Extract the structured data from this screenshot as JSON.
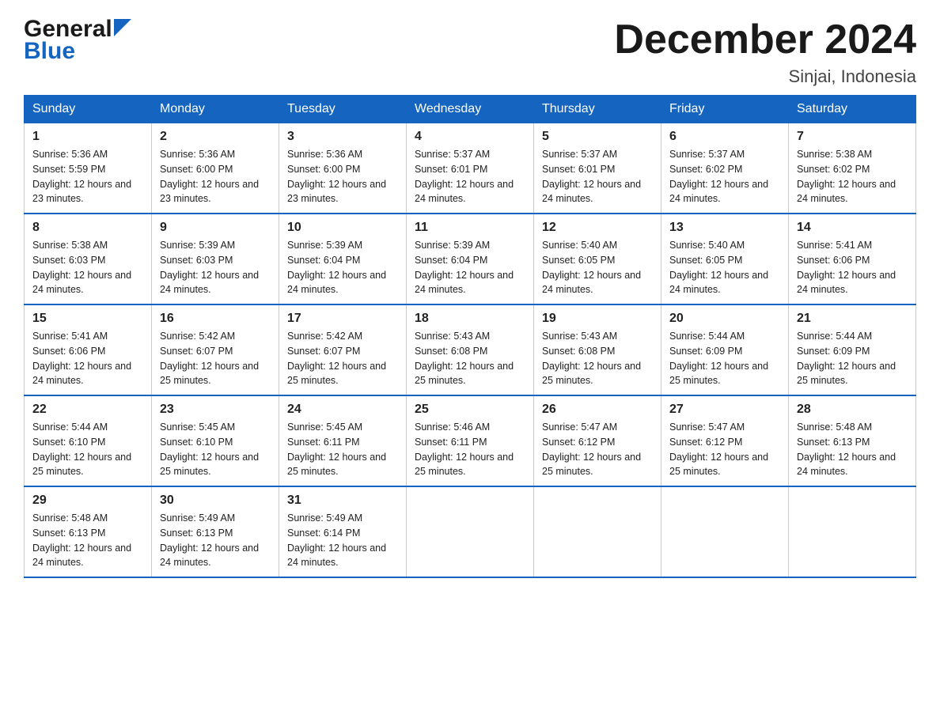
{
  "header": {
    "logo_general": "General",
    "logo_blue": "Blue",
    "title": "December 2024",
    "subtitle": "Sinjai, Indonesia"
  },
  "days_of_week": [
    "Sunday",
    "Monday",
    "Tuesday",
    "Wednesday",
    "Thursday",
    "Friday",
    "Saturday"
  ],
  "weeks": [
    [
      {
        "day": "1",
        "sunrise": "5:36 AM",
        "sunset": "5:59 PM",
        "daylight": "12 hours and 23 minutes."
      },
      {
        "day": "2",
        "sunrise": "5:36 AM",
        "sunset": "6:00 PM",
        "daylight": "12 hours and 23 minutes."
      },
      {
        "day": "3",
        "sunrise": "5:36 AM",
        "sunset": "6:00 PM",
        "daylight": "12 hours and 23 minutes."
      },
      {
        "day": "4",
        "sunrise": "5:37 AM",
        "sunset": "6:01 PM",
        "daylight": "12 hours and 24 minutes."
      },
      {
        "day": "5",
        "sunrise": "5:37 AM",
        "sunset": "6:01 PM",
        "daylight": "12 hours and 24 minutes."
      },
      {
        "day": "6",
        "sunrise": "5:37 AM",
        "sunset": "6:02 PM",
        "daylight": "12 hours and 24 minutes."
      },
      {
        "day": "7",
        "sunrise": "5:38 AM",
        "sunset": "6:02 PM",
        "daylight": "12 hours and 24 minutes."
      }
    ],
    [
      {
        "day": "8",
        "sunrise": "5:38 AM",
        "sunset": "6:03 PM",
        "daylight": "12 hours and 24 minutes."
      },
      {
        "day": "9",
        "sunrise": "5:39 AM",
        "sunset": "6:03 PM",
        "daylight": "12 hours and 24 minutes."
      },
      {
        "day": "10",
        "sunrise": "5:39 AM",
        "sunset": "6:04 PM",
        "daylight": "12 hours and 24 minutes."
      },
      {
        "day": "11",
        "sunrise": "5:39 AM",
        "sunset": "6:04 PM",
        "daylight": "12 hours and 24 minutes."
      },
      {
        "day": "12",
        "sunrise": "5:40 AM",
        "sunset": "6:05 PM",
        "daylight": "12 hours and 24 minutes."
      },
      {
        "day": "13",
        "sunrise": "5:40 AM",
        "sunset": "6:05 PM",
        "daylight": "12 hours and 24 minutes."
      },
      {
        "day": "14",
        "sunrise": "5:41 AM",
        "sunset": "6:06 PM",
        "daylight": "12 hours and 24 minutes."
      }
    ],
    [
      {
        "day": "15",
        "sunrise": "5:41 AM",
        "sunset": "6:06 PM",
        "daylight": "12 hours and 24 minutes."
      },
      {
        "day": "16",
        "sunrise": "5:42 AM",
        "sunset": "6:07 PM",
        "daylight": "12 hours and 25 minutes."
      },
      {
        "day": "17",
        "sunrise": "5:42 AM",
        "sunset": "6:07 PM",
        "daylight": "12 hours and 25 minutes."
      },
      {
        "day": "18",
        "sunrise": "5:43 AM",
        "sunset": "6:08 PM",
        "daylight": "12 hours and 25 minutes."
      },
      {
        "day": "19",
        "sunrise": "5:43 AM",
        "sunset": "6:08 PM",
        "daylight": "12 hours and 25 minutes."
      },
      {
        "day": "20",
        "sunrise": "5:44 AM",
        "sunset": "6:09 PM",
        "daylight": "12 hours and 25 minutes."
      },
      {
        "day": "21",
        "sunrise": "5:44 AM",
        "sunset": "6:09 PM",
        "daylight": "12 hours and 25 minutes."
      }
    ],
    [
      {
        "day": "22",
        "sunrise": "5:44 AM",
        "sunset": "6:10 PM",
        "daylight": "12 hours and 25 minutes."
      },
      {
        "day": "23",
        "sunrise": "5:45 AM",
        "sunset": "6:10 PM",
        "daylight": "12 hours and 25 minutes."
      },
      {
        "day": "24",
        "sunrise": "5:45 AM",
        "sunset": "6:11 PM",
        "daylight": "12 hours and 25 minutes."
      },
      {
        "day": "25",
        "sunrise": "5:46 AM",
        "sunset": "6:11 PM",
        "daylight": "12 hours and 25 minutes."
      },
      {
        "day": "26",
        "sunrise": "5:47 AM",
        "sunset": "6:12 PM",
        "daylight": "12 hours and 25 minutes."
      },
      {
        "day": "27",
        "sunrise": "5:47 AM",
        "sunset": "6:12 PM",
        "daylight": "12 hours and 25 minutes."
      },
      {
        "day": "28",
        "sunrise": "5:48 AM",
        "sunset": "6:13 PM",
        "daylight": "12 hours and 24 minutes."
      }
    ],
    [
      {
        "day": "29",
        "sunrise": "5:48 AM",
        "sunset": "6:13 PM",
        "daylight": "12 hours and 24 minutes."
      },
      {
        "day": "30",
        "sunrise": "5:49 AM",
        "sunset": "6:13 PM",
        "daylight": "12 hours and 24 minutes."
      },
      {
        "day": "31",
        "sunrise": "5:49 AM",
        "sunset": "6:14 PM",
        "daylight": "12 hours and 24 minutes."
      },
      null,
      null,
      null,
      null
    ]
  ]
}
